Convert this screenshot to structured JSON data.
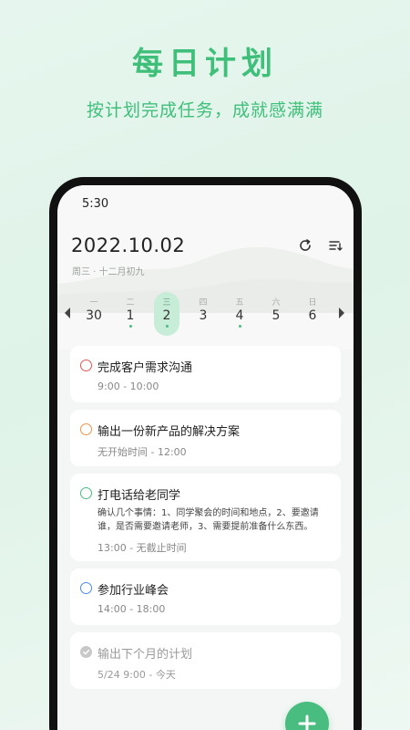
{
  "promo": {
    "title": "每日计划",
    "subtitle": "按计划完成任务，成就感满满"
  },
  "status_bar": {
    "time": "5:30"
  },
  "header": {
    "date": "2022.10.02",
    "sub_date": "周三 · 十二月初九",
    "refresh_icon": "refresh-icon",
    "sort_icon": "sort-icon"
  },
  "week": {
    "days": [
      {
        "weekday": "一",
        "date": "30",
        "dot": false,
        "selected": false
      },
      {
        "weekday": "二",
        "date": "1",
        "dot": true,
        "selected": false
      },
      {
        "weekday": "三",
        "date": "2",
        "dot": true,
        "selected": true
      },
      {
        "weekday": "四",
        "date": "3",
        "dot": false,
        "selected": false
      },
      {
        "weekday": "五",
        "date": "4",
        "dot": true,
        "selected": false
      },
      {
        "weekday": "六",
        "date": "5",
        "dot": false,
        "selected": false
      },
      {
        "weekday": "日",
        "date": "6",
        "dot": false,
        "selected": false
      }
    ]
  },
  "tasks": [
    {
      "title": "完成客户需求沟通",
      "time": "9:00 - 10:00",
      "color": "#e85454"
    },
    {
      "title": "输出一份新产品的解决方案",
      "time": "无开始时间 - 12:00",
      "color": "#f0944a"
    },
    {
      "title": "打电话给老同学",
      "description": "确认几个事情：1、同学聚会的时间和地点，2、要邀请谁，是否需要邀请老师，3、需要提前准备什么东西。",
      "time": "13:00 - 无截止时间",
      "color": "#48bd7f"
    },
    {
      "title": "参加行业峰会",
      "time": "14:00 - 18:00",
      "color": "#4a8be8"
    },
    {
      "title": "输出下个月的计划",
      "time": "5/24 9:00 - 今天",
      "color": "#c8c8c8",
      "done": true
    }
  ],
  "colors": {
    "accent": "#48bd7f",
    "title_green": "#3fbf7a"
  },
  "fab_icon": "plus-icon"
}
